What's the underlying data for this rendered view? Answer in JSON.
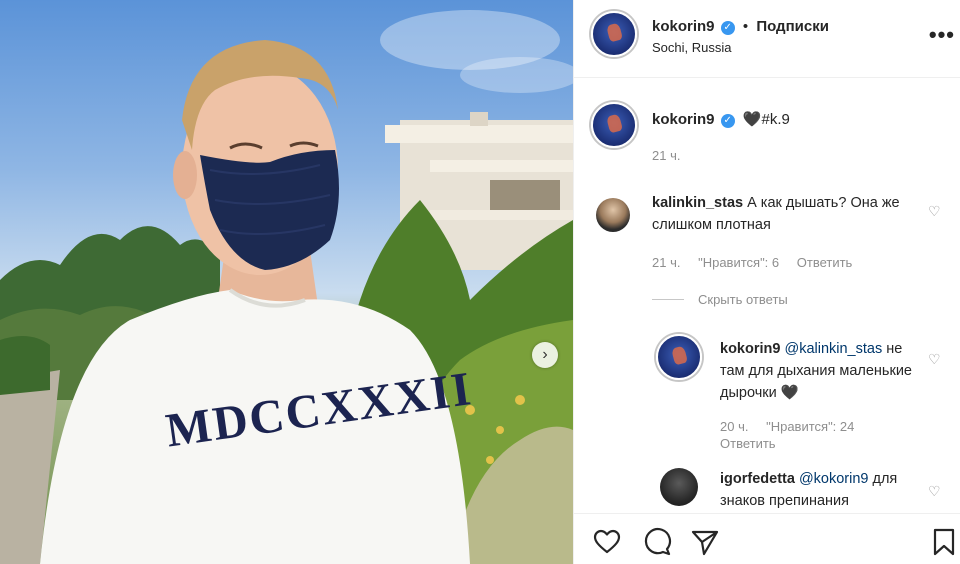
{
  "post": {
    "username": "kokorin9",
    "verified_mark": "✓",
    "separator": "•",
    "follow_label": "Подписки",
    "location": "Sochi, Russia",
    "more_label": "•••",
    "caption_text": "🖤#k.9",
    "caption_time": "21 ч."
  },
  "photo": {
    "shirt_text": "MDCCXXXII",
    "carousel_next_label": "›"
  },
  "comments": [
    {
      "username": "kalinkin_stas",
      "text": "А как дышать? Она же слишком плотная",
      "time": "21 ч.",
      "likes": "\"Нравится\": 6",
      "reply_label": "Ответить"
    },
    {
      "username": "kokorin9",
      "mention": "@kalinkin_stas",
      "text": "не там для дыхания маленькие дырочки 🖤",
      "time": "20 ч.",
      "likes": "\"Нравится\": 24",
      "reply_label": "Ответить"
    },
    {
      "username": "igorfedetta",
      "mention": "@kokorin9",
      "text": "для знаков препинания"
    }
  ],
  "hide_replies_label": "Скрыть ответы",
  "icons": {
    "like": "heart-icon",
    "comment": "comment-icon",
    "share": "send-icon",
    "save": "bookmark-icon"
  },
  "colors": {
    "verified": "#3897f0",
    "text": "#262626",
    "muted": "#8e8e8e",
    "link": "#00376b"
  }
}
